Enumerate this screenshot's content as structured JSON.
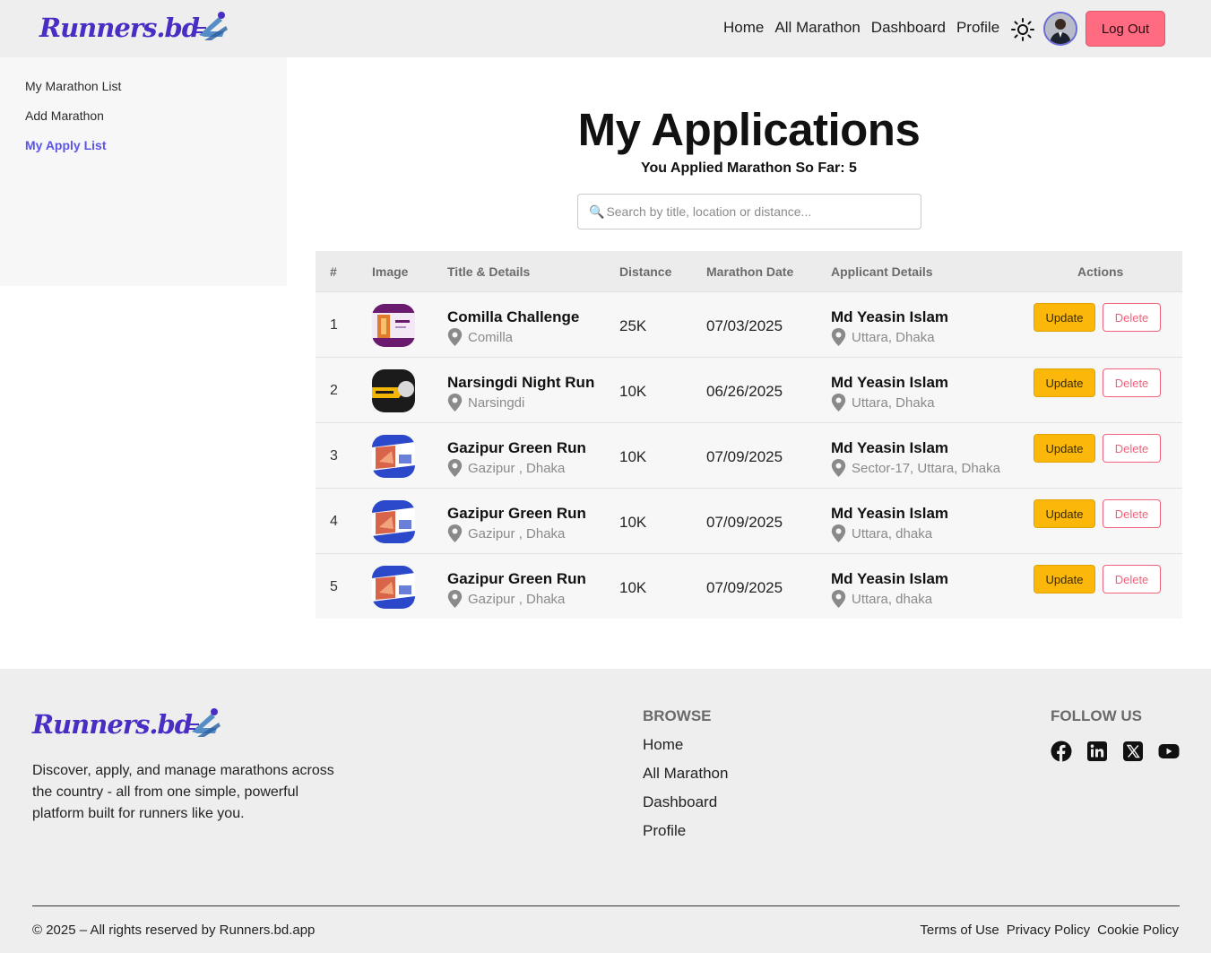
{
  "brand": {
    "name": "Runners.bd"
  },
  "nav": {
    "links": [
      "Home",
      "All Marathon",
      "Dashboard",
      "Profile"
    ],
    "theme_icon": "sun-icon",
    "logout_label": "Log Out"
  },
  "sidebar": {
    "items": [
      {
        "label": "My Marathon List",
        "active": false
      },
      {
        "label": "Add Marathon",
        "active": false
      },
      {
        "label": "My Apply List",
        "active": true
      }
    ]
  },
  "main": {
    "title": "My Applications",
    "count_text": "You Applied Marathon So Far: 5",
    "search_placeholder": "Search by title, location or distance..."
  },
  "table": {
    "headers": [
      "#",
      "Image",
      "Title & Details",
      "Distance",
      "Marathon Date",
      "Applicant Details",
      "Actions"
    ],
    "update_label": "Update",
    "delete_label": "Delete",
    "rows": [
      {
        "num": "1",
        "title": "Comilla Challenge",
        "location": "Comilla",
        "distance": "25K",
        "date": "07/03/2025",
        "applicant": "Md Yeasin Islam",
        "applicant_location": "Uttara, Dhaka",
        "thumb": "purple"
      },
      {
        "num": "2",
        "title": "Narsingdi Night Run",
        "location": "Narsingdi",
        "distance": "10K",
        "date": "06/26/2025",
        "applicant": "Md Yeasin Islam",
        "applicant_location": "Uttara, Dhaka",
        "thumb": "dark"
      },
      {
        "num": "3",
        "title": "Gazipur Green Run",
        "location": "Gazipur , Dhaka",
        "distance": "10K",
        "date": "07/09/2025",
        "applicant": "Md Yeasin Islam",
        "applicant_location": "Sector-17, Uttara, Dhaka",
        "thumb": "blue"
      },
      {
        "num": "4",
        "title": "Gazipur Green Run",
        "location": "Gazipur , Dhaka",
        "distance": "10K",
        "date": "07/09/2025",
        "applicant": "Md Yeasin Islam",
        "applicant_location": "Uttara, dhaka",
        "thumb": "blue"
      },
      {
        "num": "5",
        "title": "Gazipur Green Run",
        "location": "Gazipur , Dhaka",
        "distance": "10K",
        "date": "07/09/2025",
        "applicant": "Md Yeasin Islam",
        "applicant_location": "Uttara, dhaka",
        "thumb": "blue"
      }
    ]
  },
  "footer": {
    "description": "Discover, apply, and manage marathons across the country - all from one simple, powerful platform built for runners like you.",
    "browse_heading": "BROWSE",
    "browse_links": [
      "Home",
      "All Marathon",
      "Dashboard",
      "Profile"
    ],
    "follow_heading": "FOLLOW US",
    "social_icons": [
      "facebook-icon",
      "linkedin-icon",
      "x-icon",
      "youtube-icon"
    ],
    "copyright": "© 2025 – All rights reserved by Runners.bd.app",
    "legal_links": [
      "Terms of Use",
      "Privacy Policy",
      "Cookie Policy"
    ]
  },
  "colors": {
    "accent": "#5b55e8",
    "logout": "#ff6b81",
    "update": "#fbb80a",
    "delete": "#f0627a"
  }
}
